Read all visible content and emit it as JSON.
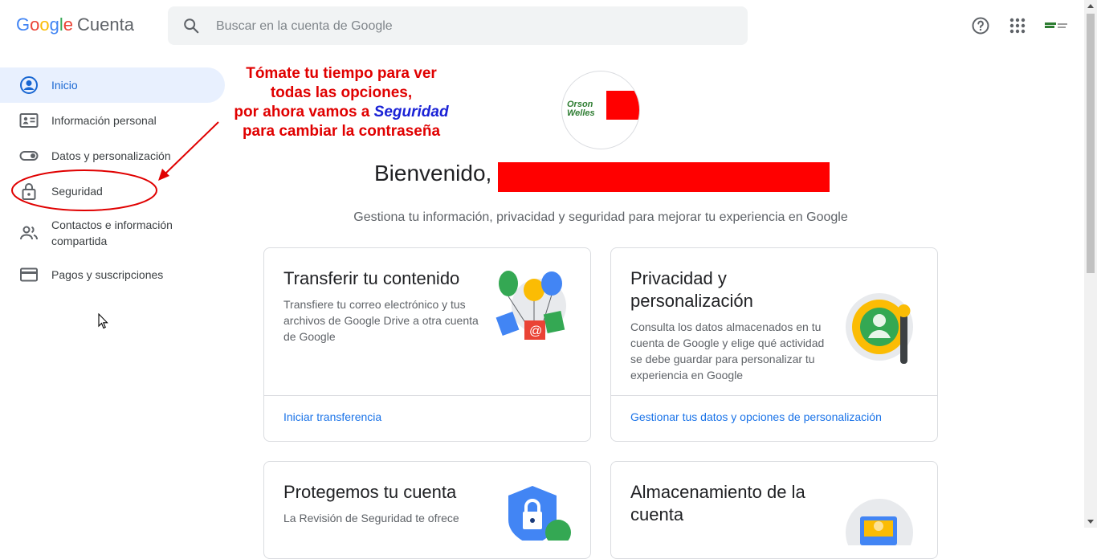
{
  "header": {
    "logo_g": [
      "G",
      "o",
      "o",
      "g",
      "l",
      "e"
    ],
    "logo_colors": [
      "#4285F4",
      "#EA4335",
      "#FBBC05",
      "#4285F4",
      "#34A853",
      "#EA4335"
    ],
    "product": "Cuenta",
    "search_placeholder": "Buscar en la cuenta de Google",
    "icons": [
      "search-icon",
      "help-icon",
      "apps-grid-icon",
      "avatar"
    ]
  },
  "sidebar": {
    "items": [
      {
        "label": "Inicio",
        "icon": "account-circle-icon",
        "active": true
      },
      {
        "label": "Información personal",
        "icon": "id-card-icon"
      },
      {
        "label": "Datos y personalización",
        "icon": "toggle-icon"
      },
      {
        "label": "Seguridad",
        "icon": "lock-icon"
      },
      {
        "label": "Contactos e información compartida",
        "icon": "people-icon"
      },
      {
        "label": "Pagos y suscripciones",
        "icon": "credit-card-icon"
      }
    ]
  },
  "annotation": {
    "line1": "Tómate tu tiempo para ver",
    "line2": "todas las opciones,",
    "line3_prefix": "por ahora vamos a ",
    "line3_em": "Seguridad",
    "line4": "para cambiar la contraseña",
    "color": "#e00000",
    "em_color": "#1a22d6"
  },
  "main": {
    "profile_text_1": "Orson",
    "profile_text_2": "Welles",
    "welcome": "Bienvenido, J",
    "subtitle": "Gestiona tu información, privacidad y seguridad para mejorar tu experiencia en Google",
    "cards": [
      {
        "title": "Transferir tu contenido",
        "body": "Transfiere tu correo electrónico y tus archivos de Google Drive a otra cuenta de Google",
        "link": "Iniciar transferencia"
      },
      {
        "title": "Privacidad y personalización",
        "body": "Consulta los datos almacenados en tu cuenta de Google y elige qué actividad se debe guardar para personalizar tu experiencia en Google",
        "link": "Gestionar tus datos y opciones de personalización"
      },
      {
        "title": "Protegemos tu cuenta",
        "body": "La Revisión de Seguridad te ofrece"
      },
      {
        "title": "Almacenamiento de la cuenta"
      }
    ]
  },
  "colors": {
    "accent": "#1a73e8",
    "active_bg": "#e8f0fe",
    "redaction": "#ff0000"
  }
}
